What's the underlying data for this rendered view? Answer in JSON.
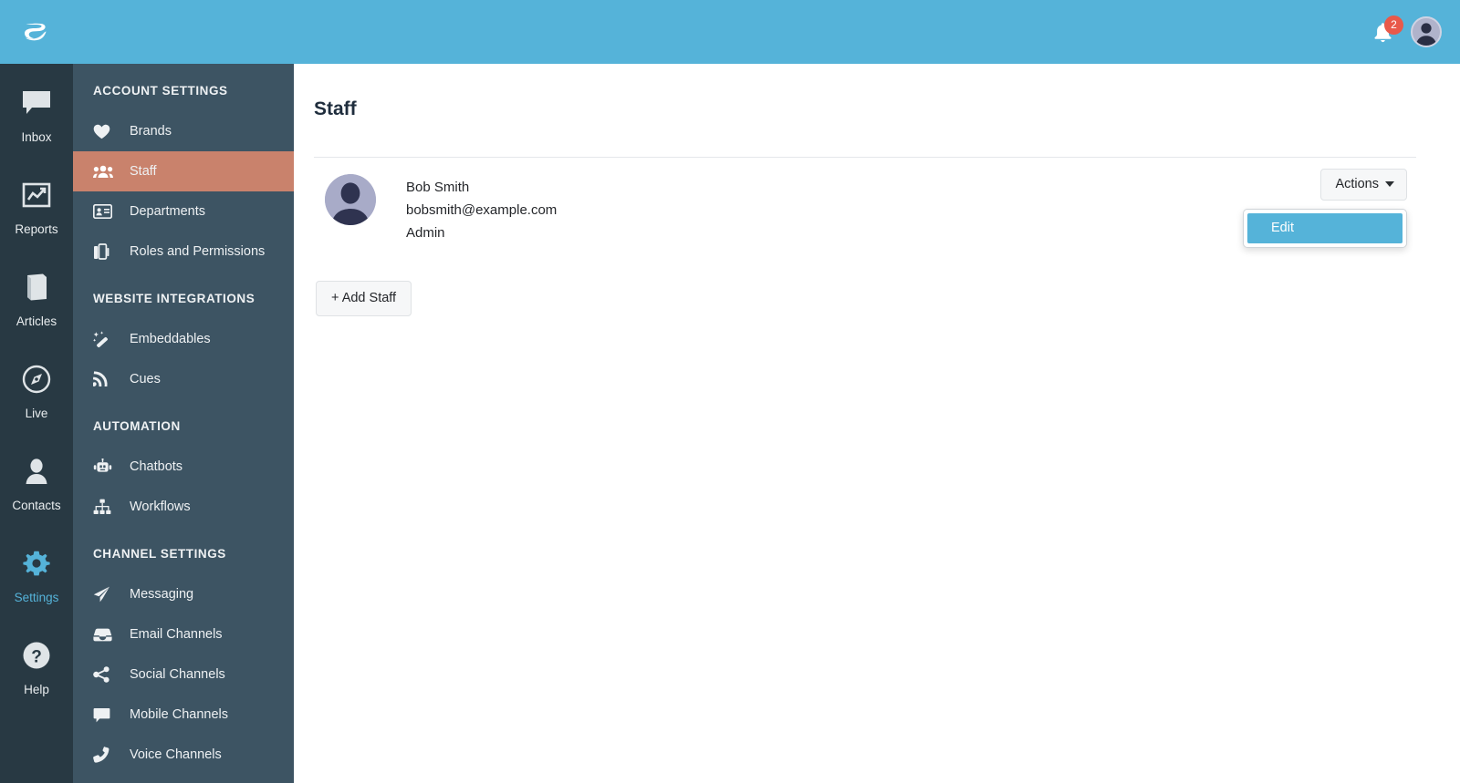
{
  "header": {
    "logo_icon": "leaf-logo-icon",
    "bell_icon": "notification-bell-icon",
    "notification_count": "2",
    "avatar_icon": "user-avatar",
    "background_color": "#55b3d9"
  },
  "rail": {
    "items": [
      {
        "label": "Inbox",
        "icon": "speech-bubble-icon",
        "active": false
      },
      {
        "label": "Reports",
        "icon": "chart-frame-icon",
        "active": false
      },
      {
        "label": "Articles",
        "icon": "book-icon",
        "active": false
      },
      {
        "label": "Live",
        "icon": "compass-icon",
        "active": false
      },
      {
        "label": "Contacts",
        "icon": "person-icon",
        "active": false
      },
      {
        "label": "Settings",
        "icon": "gear-icon",
        "active": true
      },
      {
        "label": "Help",
        "icon": "question-circle-icon",
        "active": false
      }
    ],
    "active_color": "#55b3d9",
    "background_color": "#283943"
  },
  "sidebar": {
    "background_color": "#3d5463",
    "active_color": "#c9826c",
    "sections": [
      {
        "title": "ACCOUNT SETTINGS",
        "items": [
          {
            "label": "Brands",
            "icon": "heart-icon",
            "active": false
          },
          {
            "label": "Staff",
            "icon": "people-icon",
            "active": true
          },
          {
            "label": "Departments",
            "icon": "id-card-icon",
            "active": false
          },
          {
            "label": "Roles and Permissions",
            "icon": "briefcase-icon",
            "active": false
          }
        ]
      },
      {
        "title": "WEBSITE INTEGRATIONS",
        "items": [
          {
            "label": "Embeddables",
            "icon": "magic-wand-icon",
            "active": false
          },
          {
            "label": "Cues",
            "icon": "rss-icon",
            "active": false
          }
        ]
      },
      {
        "title": "AUTOMATION",
        "items": [
          {
            "label": "Chatbots",
            "icon": "robot-icon",
            "active": false
          },
          {
            "label": "Workflows",
            "icon": "sitemap-icon",
            "active": false
          }
        ]
      },
      {
        "title": "CHANNEL SETTINGS",
        "items": [
          {
            "label": "Messaging",
            "icon": "paper-plane-icon",
            "active": false
          },
          {
            "label": "Email Channels",
            "icon": "inbox-tray-icon",
            "active": false
          },
          {
            "label": "Social Channels",
            "icon": "share-nodes-icon",
            "active": false
          },
          {
            "label": "Mobile Channels",
            "icon": "comment-icon",
            "active": false
          },
          {
            "label": "Voice Channels",
            "icon": "phone-icon",
            "active": false
          }
        ]
      }
    ]
  },
  "main": {
    "page_title": "Staff",
    "staff": {
      "avatar_icon": "staff-avatar",
      "name": "Bob Smith",
      "email": "bobsmith@example.com",
      "role": "Admin"
    },
    "actions": {
      "button_label": "Actions",
      "caret_icon": "caret-down-icon",
      "menu_items": [
        {
          "label": "Edit",
          "highlighted": true
        }
      ],
      "highlight_color": "#55b3d9"
    },
    "add_staff_label": "+ Add Staff"
  }
}
